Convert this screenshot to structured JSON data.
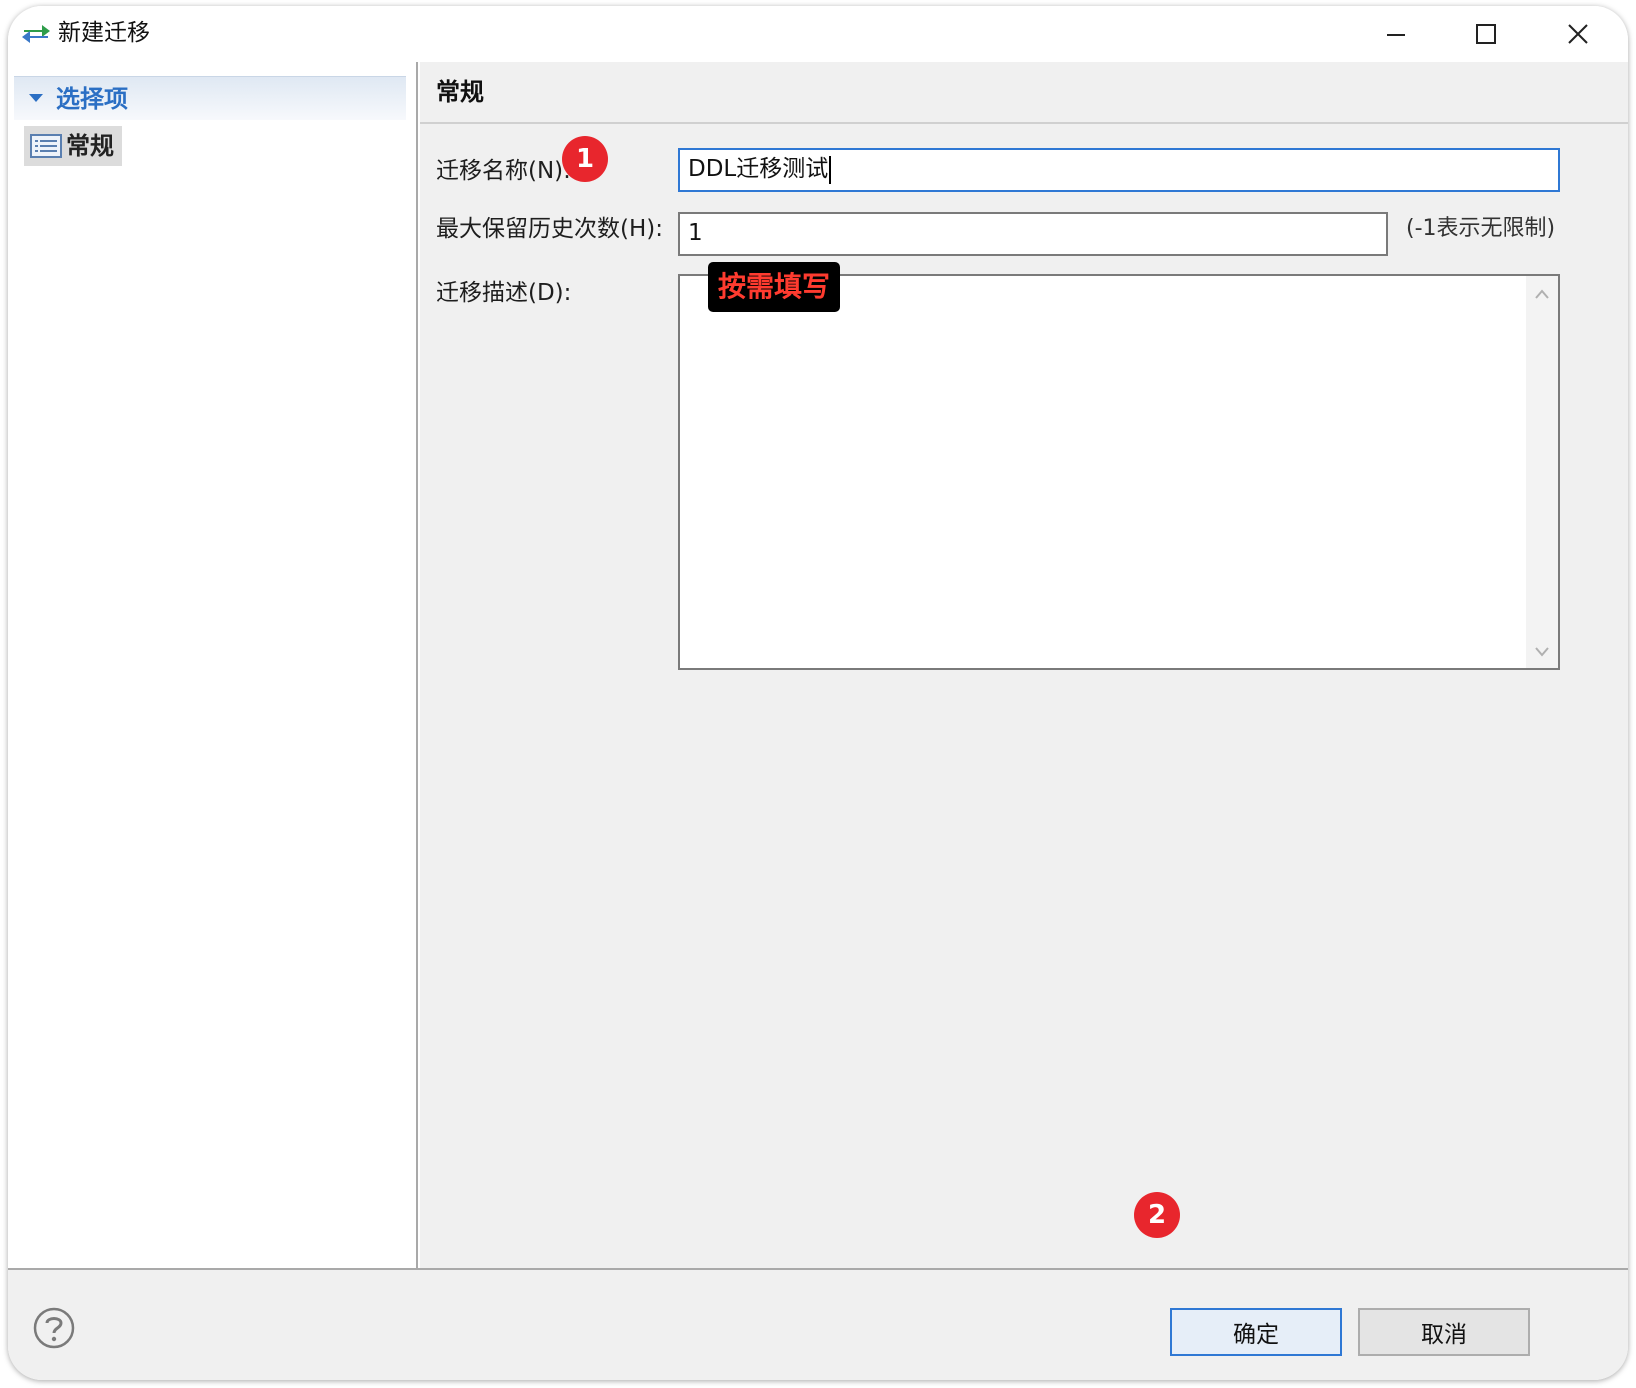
{
  "window": {
    "title": "新建迁移",
    "controls": {
      "minimize": "minimize-icon",
      "maximize": "maximize-icon",
      "close": "close-icon"
    }
  },
  "tree": {
    "header_label": "选择项",
    "items": [
      {
        "label": "常规",
        "icon": "list-icon"
      }
    ]
  },
  "section": {
    "title": "常规"
  },
  "form": {
    "name_label": "迁移名称(N):",
    "name_value": "DDL迁移测试",
    "max_history_label": "最大保留历史次数(H):",
    "max_history_value": "1",
    "max_history_hint": "(-1表示无限制)",
    "description_label": "迁移描述(D):",
    "description_value": ""
  },
  "annotations": {
    "badge_1": "1",
    "badge_2": "2",
    "fill_hint": "按需填写"
  },
  "buttons": {
    "ok_label": "确定",
    "cancel_label": "取消",
    "help_icon": "help-icon"
  },
  "colors": {
    "accent": "#2f78d4",
    "tree_header_text": "#2b6fc4",
    "badge": "#e8262d",
    "hint_text": "#ff3b2f"
  }
}
